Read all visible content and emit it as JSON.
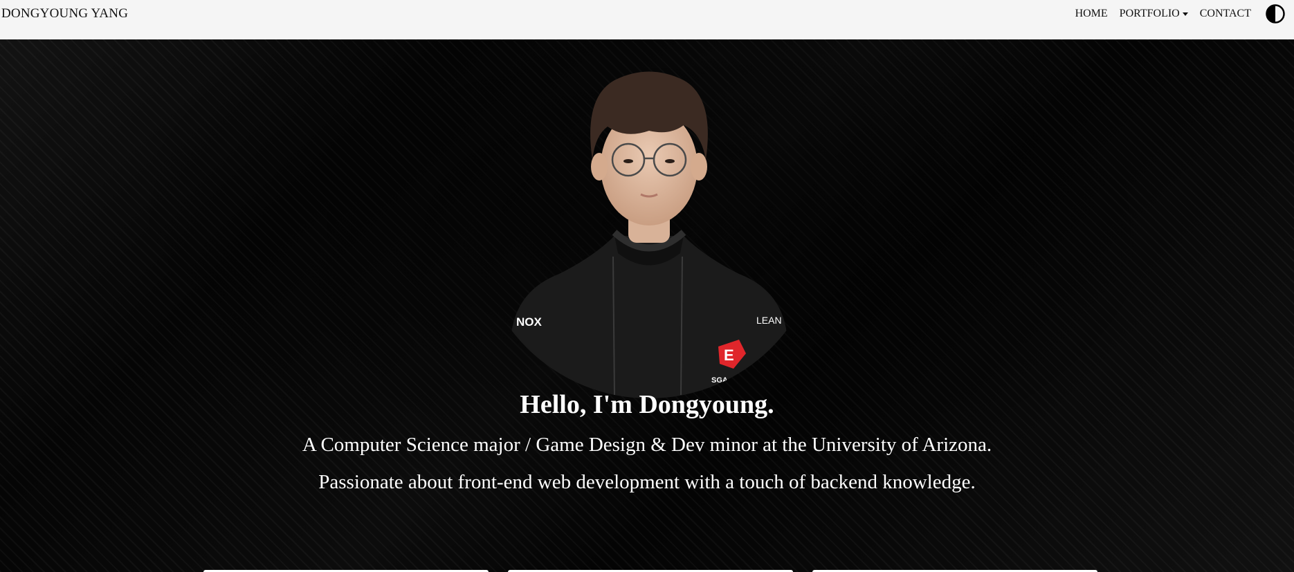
{
  "navbar": {
    "brand": "DONGYOUNG YANG",
    "links": [
      {
        "label": "HOME"
      },
      {
        "label": "PORTFOLIO",
        "dropdown": true
      },
      {
        "label": "CONTACT"
      }
    ],
    "theme_toggle_icon": "contrast-icon"
  },
  "hero": {
    "greeting": "Hello, I'm Dongyoung.",
    "tagline_1": "A Computer Science major / Game Design & Dev minor at the University of Arizona.",
    "tagline_2": "Passionate about front-end web development with a touch of backend knowledge.",
    "portrait_sleeve_left": "NOX",
    "portrait_sleeve_right": "LEAN",
    "portrait_logo": "SGA eSPORTS"
  },
  "colors": {
    "navbar_bg": "#f5f5f5",
    "hero_bg": "#0a0a0a",
    "text_light": "#ffffff",
    "accent_red": "#e0262b"
  }
}
